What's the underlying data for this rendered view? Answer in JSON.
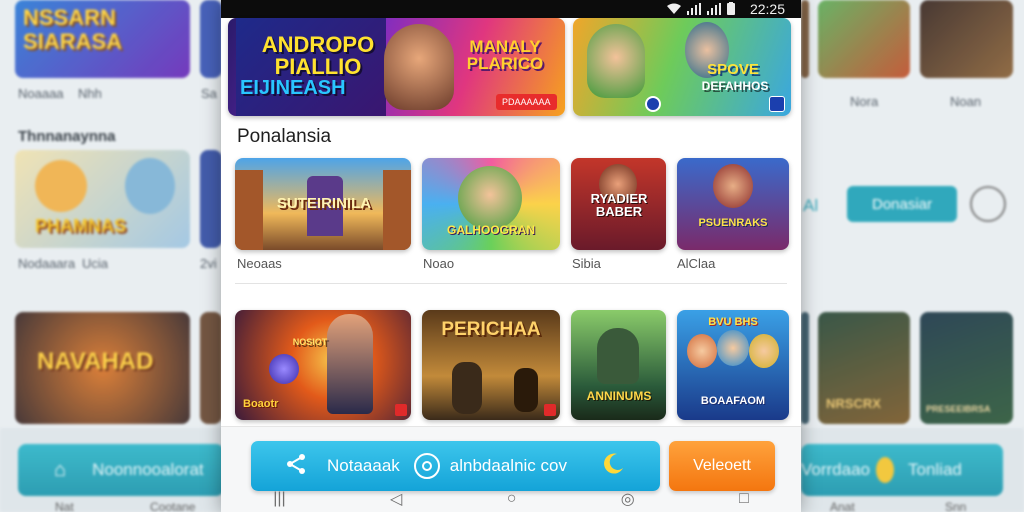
{
  "status": {
    "time": "22:25"
  },
  "background_app": {
    "top_tiles": [
      {
        "title": "NSSARN SIARASA",
        "label": "Noaaaa"
      },
      {
        "title": "",
        "label": "Nhh"
      },
      {
        "title": "",
        "label": "Sa"
      }
    ],
    "top_right_labels": [
      "Nora",
      "Noan"
    ],
    "section_heading": "Thnnanaynna",
    "mid_tiles": [
      {
        "title": "PHAMNAS",
        "label": "Nodaaara"
      },
      {
        "title": "",
        "label": "Ucia"
      },
      {
        "title": "",
        "label": "2vi"
      }
    ],
    "mid_right_fragment": "Al",
    "mid_pill": "Donasiar",
    "low_tiles": [
      {
        "title": "NAVAHAD"
      },
      {
        "title": "NRSCRX"
      },
      {
        "title": "PRESEEIBRSA"
      }
    ],
    "bottom_buttons": {
      "left": "Noonnooalorat",
      "right_partial": "Vorrdaao",
      "right": "Tonliad"
    },
    "bottom_nav": [
      "Nat",
      "Cootane",
      "Anat",
      "Snn"
    ]
  },
  "banners": [
    {
      "title": "ANDROPO PIALLIO",
      "subtitle": "EIJINEASH",
      "title2": "MANALY PLARICO",
      "badge": "PDAAAAAA"
    },
    {
      "title": "SPOVE",
      "subtitle": "DEFAHHOS",
      "badge": ""
    }
  ],
  "section_title": "Ponalansia",
  "row1": [
    {
      "art": "SUTEIRINILA",
      "label": "Neoaas"
    },
    {
      "art": "GALHOOGRAN",
      "label": "Noao"
    },
    {
      "art": "RYADIER BABER",
      "label": "Sibia"
    },
    {
      "art": "PSUENRAKS",
      "label": "AlClaa"
    }
  ],
  "row2": [
    {
      "art": "NOSIOT",
      "badge": "Boaotr"
    },
    {
      "art": "PERICHAA",
      "badge": ""
    },
    {
      "art": "ANNINUMS",
      "badge": ""
    },
    {
      "art": "BOAAFAOM",
      "top": "BVU BHS"
    }
  ],
  "actions": {
    "share_label": "Notaaaak",
    "share_suffix": "alnbdaalnic cov",
    "welcome_label": "Veleoett"
  },
  "nav": [
    "|||",
    "◁",
    "○",
    "◎",
    "□"
  ]
}
